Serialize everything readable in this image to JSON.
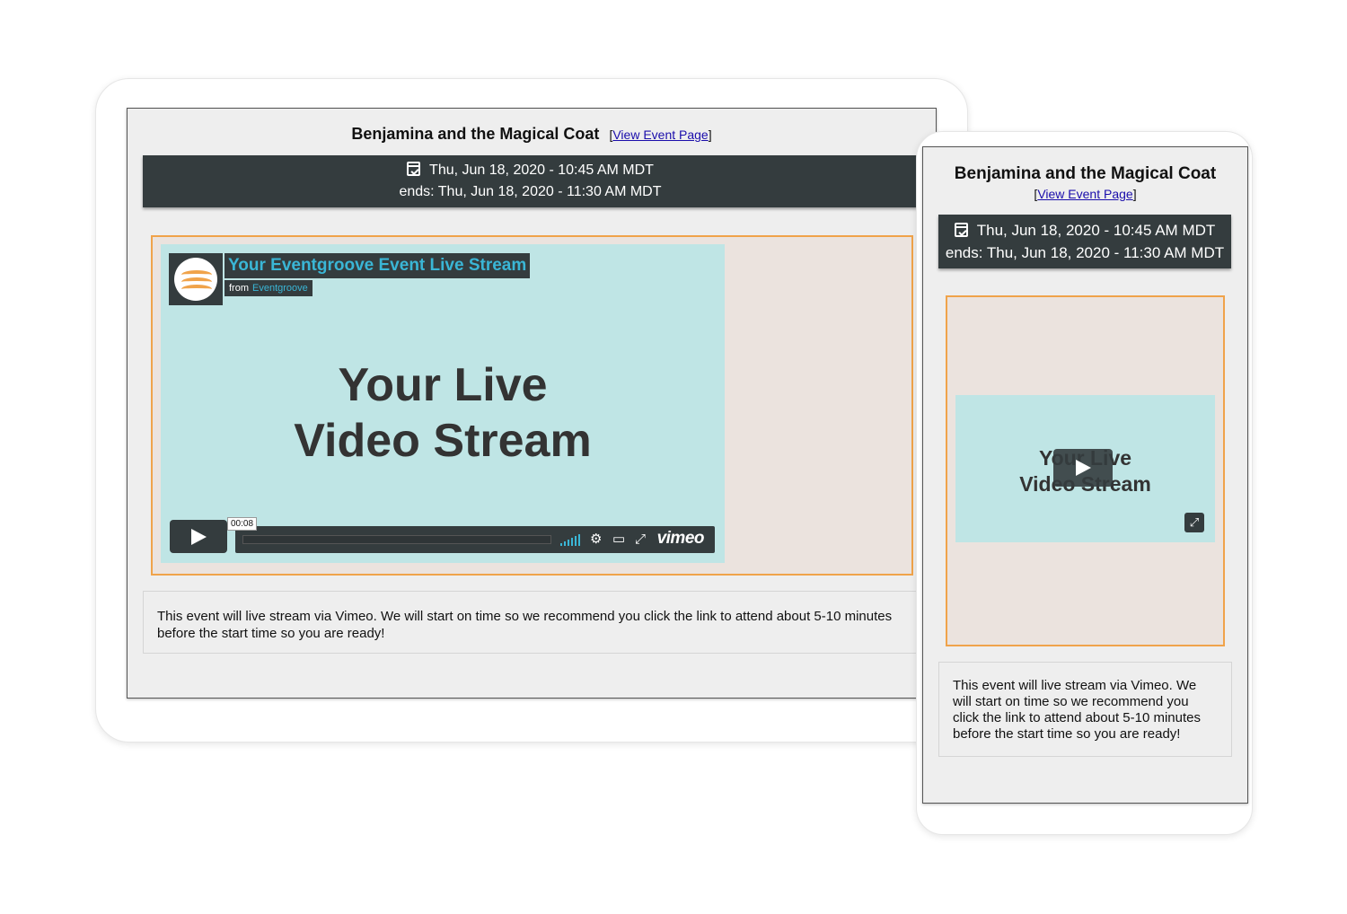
{
  "event": {
    "title": "Benjamina and the Magical Coat",
    "link_label": "View Event Page",
    "bracket_open": "[",
    "bracket_close": "]",
    "start": "Thu, Jun 18, 2020 - 10:45 AM MDT",
    "end": "ends: Thu, Jun 18, 2020 - 11:30 AM MDT",
    "description": "This event will live stream via Vimeo. We will start on time so we recommend you click the link to attend about 5-10 minutes before the start time so you are ready!"
  },
  "video": {
    "title": "Your Eventgroove Event Live Stream",
    "from_label": "from",
    "from_brand": "Eventgroove",
    "placeholder_line1": "Your Live",
    "placeholder_line2": "Video Stream",
    "timestamp": "00:08",
    "player_brand": "vimeo"
  },
  "icons": {
    "calendar": "calendar-check-icon",
    "play": "play-icon",
    "settings": "gear-icon",
    "airplay": "airplay-icon",
    "fullscreen": "fullscreen-icon",
    "volume": "volume-bars-icon"
  },
  "colors": {
    "date_bar": "#343c3e",
    "frame_border": "#f0a34a",
    "video_bg": "#bfe5e5",
    "brand_blue": "#3ab6d6",
    "frame_bg": "#ebe3de"
  }
}
